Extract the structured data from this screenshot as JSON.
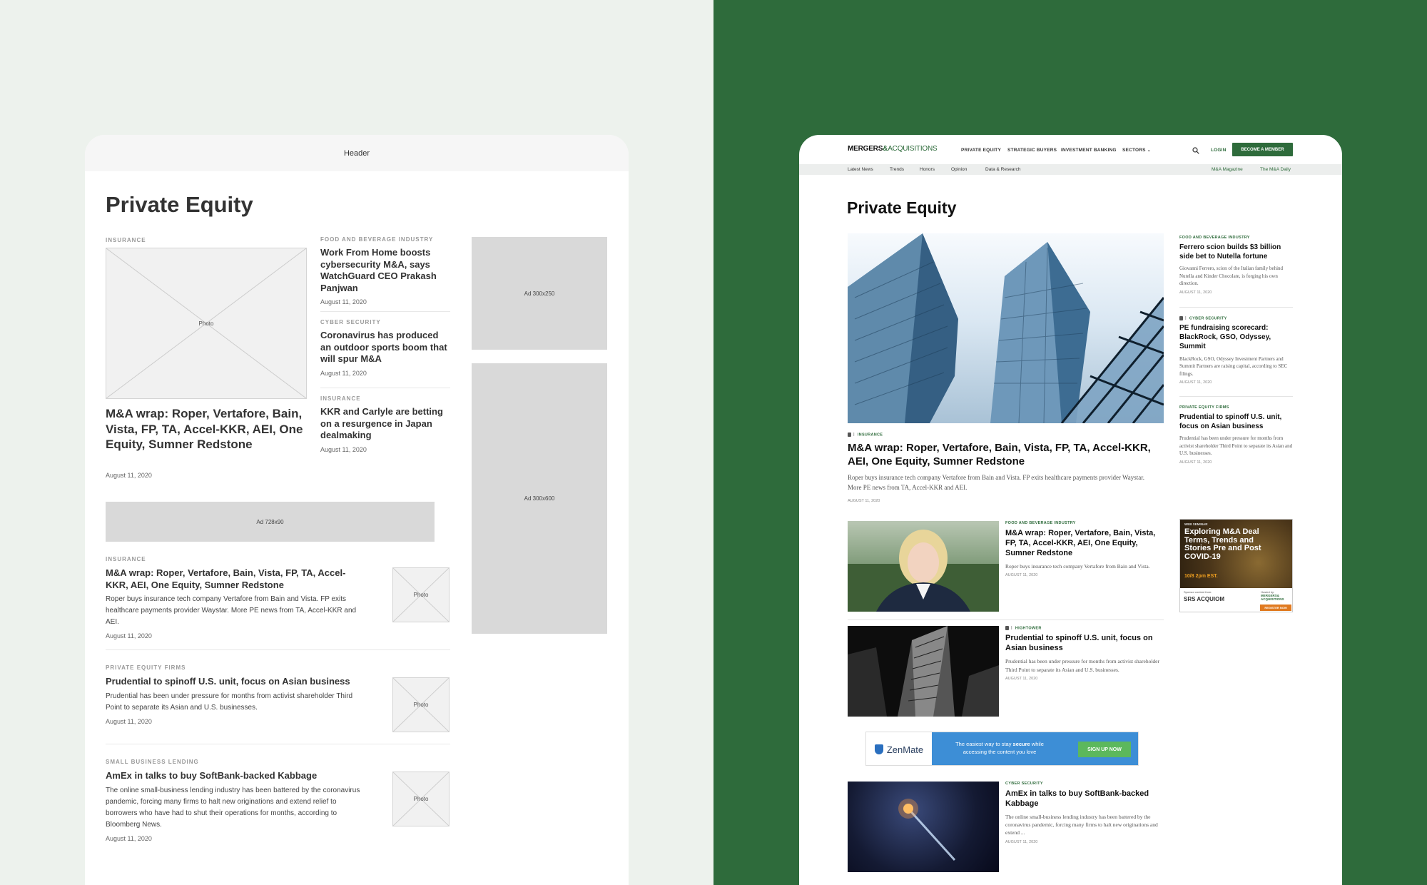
{
  "wireframe": {
    "header_label": "Header",
    "page_title": "Private Equity",
    "photo_label": "Photo",
    "featured": {
      "category": "INSURANCE",
      "headline": "M&A wrap: Roper, Vertafore, Bain, Vista, FP, TA, Accel-KKR, AEI, One Equity, Sumner Redstone",
      "date": "August 11, 2020"
    },
    "side_stories": [
      {
        "category": "FOOD AND BEVERAGE INDUSTRY",
        "headline": "Work From Home boosts cybersecurity M&A, says WatchGuard CEO Prakash Panjwan",
        "date": "August 11, 2020"
      },
      {
        "category": "CYBER SECURITY",
        "headline": "Coronavirus has produced an outdoor sports boom that will spur M&A",
        "date": "August 11, 2020"
      },
      {
        "category": "INSURANCE",
        "headline": "KKR and Carlyle are betting on a resurgence in Japan dealmaking",
        "date": "August 11, 2020"
      }
    ],
    "ads": {
      "box_300x250": "Ad 300x250",
      "box_300x600": "Ad 300x600",
      "leaderboard": "Ad 728x90"
    },
    "list_stories": [
      {
        "category": "INSURANCE",
        "headline": "M&A wrap: Roper, Vertafore, Bain, Vista, FP, TA, Accel-KKR, AEI, One Equity, Sumner Redstone",
        "desc": "Roper buys insurance tech company Vertafore from Bain and Vista. FP exits healthcare payments provider Waystar. More PE news from TA, Accel-KKR and AEI.",
        "date": "August 11, 2020"
      },
      {
        "category": "PRIVATE EQUITY FIRMS",
        "headline": "Prudential to spinoff U.S. unit, focus on Asian business",
        "desc": "Prudential has been under pressure for months from activist shareholder Third Point to separate its Asian and U.S. businesses.",
        "date": "August 11, 2020"
      },
      {
        "category": "SMALL BUSINESS LENDING",
        "headline": "AmEx in talks to buy SoftBank-backed Kabbage",
        "desc": "The online small-business lending industry has been battered by the coronavirus pandemic, forcing many firms to halt new originations and extend relief to borrowers who have had to shut their operations for months, according to Bloomberg News.",
        "date": "August 11, 2020"
      }
    ]
  },
  "site": {
    "logo": {
      "part1": "MERGERS",
      "amp": "&",
      "part2": "ACQUISITIONS"
    },
    "nav": [
      "PRIVATE EQUITY",
      "STRATEGIC BUYERS",
      "INVESTMENT BANKING",
      "SECTORS"
    ],
    "login": "LOGIN",
    "cta": "BECOME A MEMBER",
    "subnav": [
      "Latest News",
      "Trends",
      "Honors",
      "Opinion",
      "Data & Research"
    ],
    "subnav_right": [
      "M&A Magazine",
      "The M&A Daily"
    ],
    "page_title": "Private Equity",
    "hero": {
      "category": "INSURANCE",
      "headline": "M&A wrap: Roper, Vertafore, Bain, Vista, FP, TA, Accel-KKR, AEI, One Equity, Sumner Redstone",
      "desc": "Roper buys insurance tech company Vertafore from Bain and Vista. FP exits healthcare payments provider Waystar. More PE news from TA, Accel-KKR and AEI.",
      "date": "AUGUST 11, 2020"
    },
    "sidebar": [
      {
        "category": "FOOD AND BEVERAGE INDUSTRY",
        "headline": "Ferrero scion builds $3 billion side bet to Nutella fortune",
        "desc": "Giovanni Ferrero, scion of the Italian family behind Nutella and Kinder Chocolate, is forging his own direction.",
        "date": "AUGUST 11, 2020"
      },
      {
        "category": "CYBER SECURITY",
        "headline": "PE fundraising scorecard: BlackRock, GSO, Odyssey, Summit",
        "desc": "BlackRock, GSO, Odyssey Investment Partners and Summit Partners are raising capital, according to SEC filings.",
        "date": "AUGUST 11, 2020"
      },
      {
        "category": "PRIVATE EQUITY FIRMS",
        "headline": "Prudential to spinoff U.S. unit, focus on Asian business",
        "desc": "Prudential has been under pressure for months from activist shareholder Third Point to separate its Asian and U.S. businesses.",
        "date": "AUGUST 11, 2020"
      }
    ],
    "list": [
      {
        "category": "FOOD AND BEVERAGE INDUSTRY",
        "headline": "M&A wrap: Roper, Vertafore, Bain, Vista, FP, TA, Accel-KKR, AEI, One Equity, Sumner Redstone",
        "desc": "Roper buys insurance tech company Vertafore from Bain and Vista.",
        "date": "AUGUST 11, 2020"
      },
      {
        "category": "HIGHTOWER",
        "headline": "Prudential to spinoff U.S. unit, focus on Asian business",
        "desc": "Prudential has been under pressure for months from activist shareholder Third Point to separate its Asian and U.S. businesses.",
        "date": "AUGUST 11, 2020"
      },
      {
        "category": "CYBER SECURITY",
        "headline": "AmEx in talks to buy SoftBank-backed Kabbage",
        "desc": "The online small-business lending industry has been battered by the coronavirus pandemic, forcing many firms to halt new originations and extend ...",
        "date": "AUGUST 11, 2020"
      }
    ],
    "webinar_ad": {
      "tag": "WEB SEMINAR",
      "title": "Exploring M&A Deal Terms, Trends and Stories Pre and Post COVID-19",
      "time": "10/8 2pm EST.",
      "sponsor_label": "Sponsor content from:",
      "sponsor": "SRS ACQUIOM",
      "host_label": "Hosted by:",
      "host": "MERGERS& ACQUISITIONS",
      "cta": "REGISTER NOW"
    },
    "zenmate_ad": {
      "brand": "ZenMate",
      "text_part1": "The easiest way to stay ",
      "text_bold": "secure",
      "text_part2": " while accessing the content you love",
      "cta": "SIGN UP NOW"
    }
  }
}
